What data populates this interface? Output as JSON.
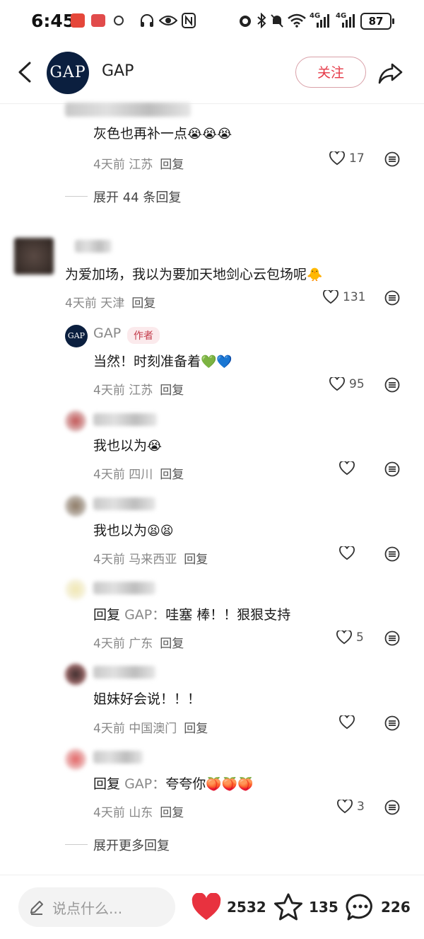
{
  "status_bar": {
    "time": "6:45",
    "battery": "87",
    "net1": "4G",
    "net2": "4G"
  },
  "header": {
    "avatar_text": "GAP",
    "name": "GAP",
    "follow_label": "关注"
  },
  "comments": [
    {
      "text": "灰色也再补一点",
      "emoji": "😭😭😭",
      "time": "4天前",
      "location": "江苏",
      "reply": "回复",
      "likes": "17"
    },
    {
      "text": "为爱加场，我以为要加天地剑心云包场呢",
      "emoji": "🐥",
      "time": "4天前",
      "location": "天津",
      "reply": "回复",
      "likes": "131"
    }
  ],
  "expand_top": "展开 44 条回复",
  "replies": [
    {
      "author": "GAP",
      "tag": "作者",
      "text": "当然！时刻准备着",
      "emoji": "💚💙",
      "time": "4天前",
      "location": "江苏",
      "reply": "回复",
      "likes": "95"
    },
    {
      "text": "我也以为",
      "emoji": "😭",
      "time": "4天前",
      "location": "四川",
      "reply": "回复",
      "likes": ""
    },
    {
      "text": "我也以为",
      "emoji": "😫😫",
      "time": "4天前",
      "location": "马来西亚",
      "reply": "回复",
      "likes": ""
    },
    {
      "prefix": "回复",
      "target": "GAP：",
      "text": "哇塞 棒！！狠狠支持",
      "time": "4天前",
      "location": "广东",
      "reply": "回复",
      "likes": "5"
    },
    {
      "text": "姐妹好会说！！！",
      "time": "4天前",
      "location": "中国澳门",
      "reply": "回复",
      "likes": ""
    },
    {
      "prefix": "回复",
      "target": "GAP：",
      "text": "夸夸你",
      "emoji": "🍑🍑🍑",
      "time": "4天前",
      "location": "山东",
      "reply": "回复",
      "likes": "3"
    }
  ],
  "expand_bottom": "展开更多回复",
  "bottom_bar": {
    "input_placeholder": "说点什么...",
    "likes": "2532",
    "favorites": "135",
    "comments": "226"
  },
  "colors": {
    "accent": "#e53a48",
    "heart_filled": "#e8323f",
    "gap_navy": "#0b1f3f"
  }
}
